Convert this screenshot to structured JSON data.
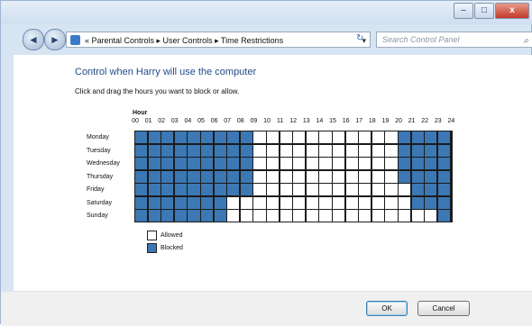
{
  "window": {
    "controls": {
      "minimize": "–",
      "maximize": "□",
      "close": "x"
    }
  },
  "navbar": {
    "back_glyph": "◄",
    "forward_glyph": "►",
    "breadcrumb": "« Parental Controls ▸ User Controls ▸ Time Restrictions",
    "dropdown_glyph": "▾",
    "refresh_glyph": "↻",
    "search_placeholder": "Search Control Panel",
    "search_glyph": "⌕"
  },
  "main": {
    "heading": "Control when Harry will use the computer",
    "instructions": "Click and drag the hours you want to block or allow.",
    "hour_label": "Hour",
    "hours": [
      "00",
      "01",
      "02",
      "03",
      "04",
      "05",
      "06",
      "07",
      "08",
      "09",
      "10",
      "11",
      "12",
      "13",
      "14",
      "15",
      "16",
      "17",
      "18",
      "19",
      "20",
      "21",
      "22",
      "23",
      "24"
    ],
    "days": [
      "Monday",
      "Tuesday",
      "Wednesday",
      "Thursday",
      "Friday",
      "Saturday",
      "Sunday"
    ],
    "schedule": [
      {
        "day": "Monday",
        "blocked_hours": [
          0,
          1,
          2,
          3,
          4,
          5,
          6,
          7,
          8,
          20,
          21,
          22,
          23
        ]
      },
      {
        "day": "Tuesday",
        "blocked_hours": [
          0,
          1,
          2,
          3,
          4,
          5,
          6,
          7,
          8,
          20,
          21,
          22,
          23
        ]
      },
      {
        "day": "Wednesday",
        "blocked_hours": [
          0,
          1,
          2,
          3,
          4,
          5,
          6,
          7,
          8,
          20,
          21,
          22,
          23
        ]
      },
      {
        "day": "Thursday",
        "blocked_hours": [
          0,
          1,
          2,
          3,
          4,
          5,
          6,
          7,
          8,
          20,
          21,
          22,
          23
        ]
      },
      {
        "day": "Friday",
        "blocked_hours": [
          0,
          1,
          2,
          3,
          4,
          5,
          6,
          7,
          8,
          21,
          22,
          23
        ]
      },
      {
        "day": "Saturday",
        "blocked_hours": [
          0,
          1,
          2,
          3,
          4,
          5,
          6,
          21,
          22,
          23
        ]
      },
      {
        "day": "Sunday",
        "blocked_hours": [
          0,
          1,
          2,
          3,
          4,
          5,
          6,
          23
        ]
      }
    ],
    "legend": {
      "allowed": "Allowed",
      "blocked": "Blocked"
    },
    "colors": {
      "blocked": "#3b78b4",
      "allowed": "#ffffff"
    }
  },
  "footer": {
    "ok_label": "OK",
    "cancel_label": "Cancel"
  }
}
